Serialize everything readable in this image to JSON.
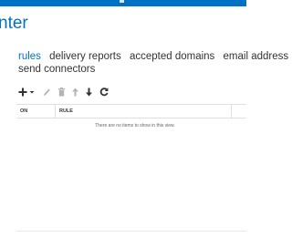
{
  "app": {
    "title_fragment": "nter"
  },
  "nav": {
    "items": [
      {
        "label": "rules",
        "active": true
      },
      {
        "label": "delivery reports",
        "active": false
      },
      {
        "label": "accepted domains",
        "active": false
      },
      {
        "label": "email address p",
        "active": false
      },
      {
        "label": "send connectors",
        "active": false
      }
    ]
  },
  "toolbar": {
    "icons": [
      "add-icon",
      "dropdown-arrow-icon",
      "edit-icon",
      "delete-icon",
      "move-up-icon",
      "move-down-icon",
      "refresh-icon"
    ]
  },
  "grid": {
    "columns": [
      {
        "label": "ON"
      },
      {
        "label": "RULE"
      }
    ],
    "empty_message": "There are no items to show in this view."
  },
  "colors": {
    "accent": "#0072c6",
    "toolbar_icon": "#333333",
    "disabled_icon": "#b4b4b4"
  }
}
